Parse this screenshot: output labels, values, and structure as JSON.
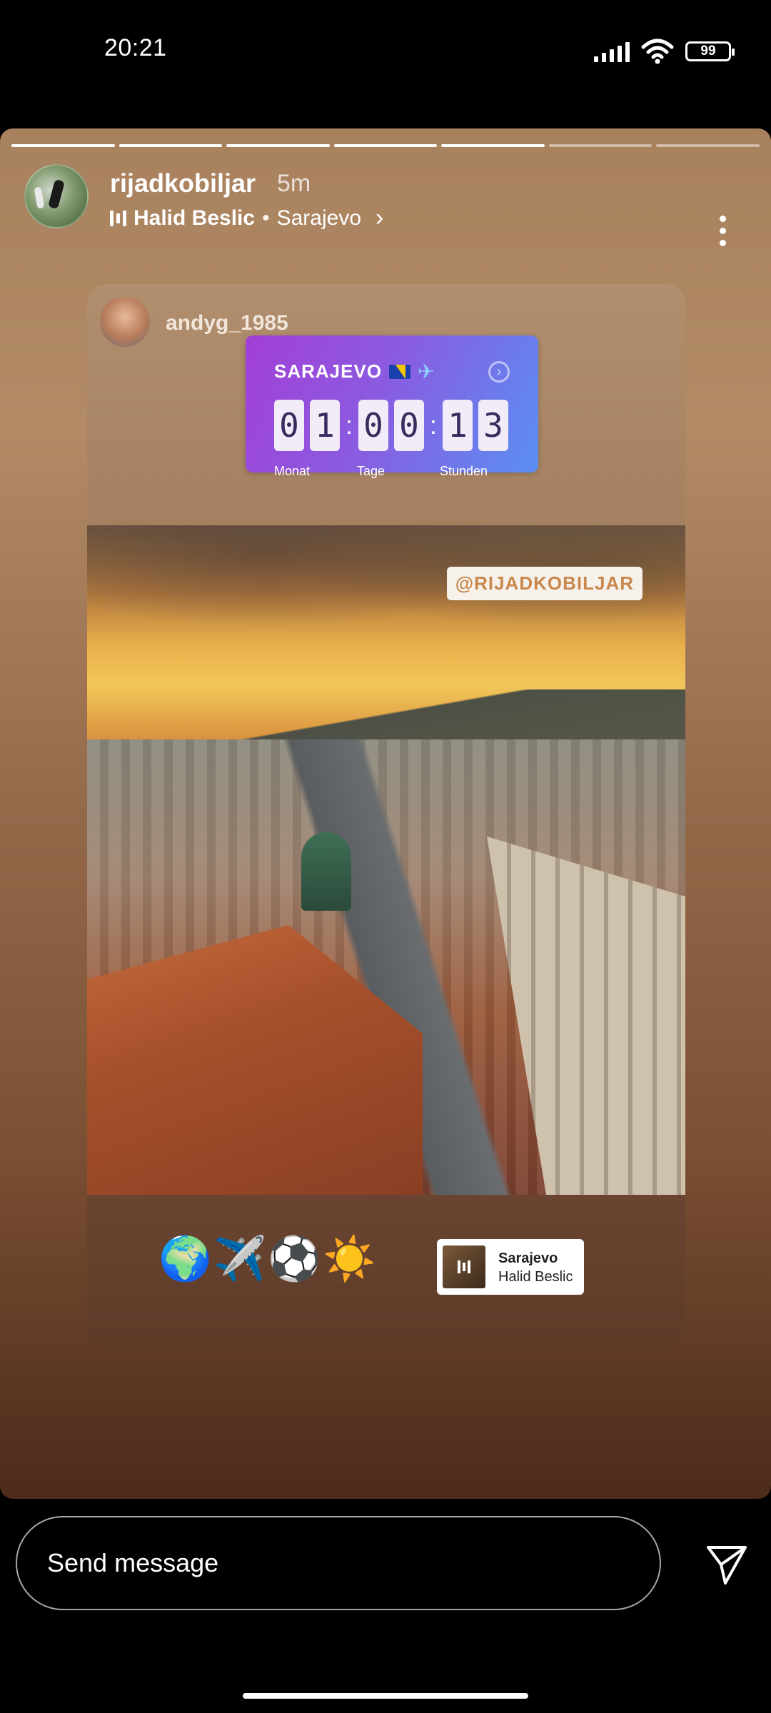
{
  "status_bar": {
    "time": "20:21",
    "battery": "99"
  },
  "story": {
    "progress_segments": 7,
    "progress_completed": 5,
    "username": "rijadkobiljar",
    "time_ago": "5m",
    "music": {
      "artist": "Halid Beslic",
      "separator": "•",
      "song": "Sarajevo"
    }
  },
  "reposted": {
    "username": "andyg_1985",
    "countdown": {
      "title": "SARAJEVO",
      "digits": [
        "0",
        "1",
        "0",
        "0",
        "1",
        "3"
      ],
      "labels": [
        "Monat",
        "Tage",
        "Stunden"
      ]
    },
    "mention": "@RIJADKOBILJAR",
    "emojis": "🌍✈️⚽☀️",
    "music_sticker": {
      "title": "Sarajevo",
      "artist": "Halid Beslic"
    }
  },
  "message_bar": {
    "placeholder": "Send message"
  }
}
